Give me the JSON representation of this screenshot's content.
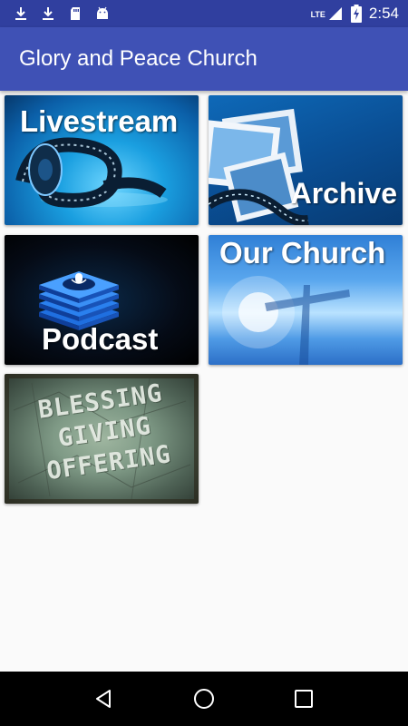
{
  "status_bar": {
    "time": "2:54",
    "network": "LTE",
    "icons": [
      "download-icon",
      "download-icon",
      "sd-card-icon",
      "android-icon",
      "signal-icon",
      "battery-icon"
    ]
  },
  "app_bar": {
    "title": "Glory and Peace Church",
    "color": "#3f51b5"
  },
  "tiles": [
    {
      "label": "Livestream"
    },
    {
      "label": "Archive"
    },
    {
      "label": "Podcast"
    },
    {
      "label": "Our Church"
    },
    {
      "label": "BLESSING GIVING OFFERING"
    }
  ],
  "nav_bar": {
    "buttons": [
      "back-icon",
      "home-icon",
      "recents-icon"
    ]
  }
}
